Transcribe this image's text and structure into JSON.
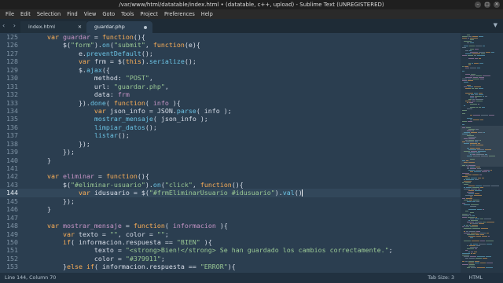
{
  "window": {
    "title": "/var/www/html/datatable/index.html • (datatable, c++, upload) - Sublime Text (UNREGISTERED)",
    "controls": [
      "–",
      "□",
      "✕"
    ]
  },
  "menu": [
    "File",
    "Edit",
    "Selection",
    "Find",
    "View",
    "Goto",
    "Tools",
    "Project",
    "Preferences",
    "Help"
  ],
  "tabs": [
    {
      "label": "index.html",
      "active": false,
      "close": "✕"
    },
    {
      "label": "guardar.php",
      "active": true,
      "dirty": true
    }
  ],
  "tab_nav": "‹ ›",
  "tab_dropdown": "▼",
  "editor": {
    "active_line": 144,
    "lines": [
      {
        "n": "125",
        "tokens": [
          [
            "kw",
            "    var "
          ],
          [
            "nv",
            "guardar"
          ],
          [
            "pl",
            " = "
          ],
          [
            "kw",
            "function"
          ],
          [
            "pl",
            "(){"
          ]
        ]
      },
      {
        "n": "126",
        "tokens": [
          [
            "pl",
            "        $("
          ],
          [
            "str",
            "\"form\""
          ],
          [
            "pl",
            ")."
          ],
          [
            "fn",
            "on"
          ],
          [
            "pl",
            "("
          ],
          [
            "str",
            "\"submit\""
          ],
          [
            "pl",
            ", "
          ],
          [
            "kw",
            "function"
          ],
          [
            "pl",
            "(e){"
          ]
        ]
      },
      {
        "n": "127",
        "tokens": [
          [
            "pl",
            "            e."
          ],
          [
            "fn",
            "preventDefault"
          ],
          [
            "pl",
            "();"
          ]
        ]
      },
      {
        "n": "128",
        "tokens": [
          [
            "kw",
            "            var "
          ],
          [
            "pl",
            "frm = $("
          ],
          [
            "kw",
            "this"
          ],
          [
            "pl",
            ")."
          ],
          [
            "fn",
            "serialize"
          ],
          [
            "pl",
            "();"
          ]
        ]
      },
      {
        "n": "129",
        "tokens": [
          [
            "pl",
            "            $."
          ],
          [
            "fn",
            "ajax"
          ],
          [
            "pl",
            "({"
          ]
        ]
      },
      {
        "n": "130",
        "tokens": [
          [
            "pl",
            "                method: "
          ],
          [
            "str",
            "\"POST\""
          ],
          [
            "pl",
            ","
          ]
        ]
      },
      {
        "n": "131",
        "tokens": [
          [
            "pl",
            "                url: "
          ],
          [
            "str",
            "\"guardar.php\""
          ],
          [
            "pl",
            ","
          ]
        ]
      },
      {
        "n": "132",
        "tokens": [
          [
            "pl",
            "                data: "
          ],
          [
            "nv",
            "frm"
          ]
        ]
      },
      {
        "n": "133",
        "tokens": [
          [
            "pl",
            "            })."
          ],
          [
            "fn",
            "done"
          ],
          [
            "pl",
            "( "
          ],
          [
            "kw",
            "function"
          ],
          [
            "pl",
            "( "
          ],
          [
            "nv",
            "info"
          ],
          [
            "pl",
            " ){"
          ]
        ]
      },
      {
        "n": "134",
        "tokens": [
          [
            "kw",
            "                var "
          ],
          [
            "pl",
            "json_info = JSON."
          ],
          [
            "fn",
            "parse"
          ],
          [
            "pl",
            "( info );"
          ]
        ]
      },
      {
        "n": "135",
        "tokens": [
          [
            "pl",
            "                "
          ],
          [
            "fn",
            "mostrar_mensaje"
          ],
          [
            "pl",
            "( json_info );"
          ]
        ]
      },
      {
        "n": "136",
        "tokens": [
          [
            "pl",
            "                "
          ],
          [
            "fn",
            "limpiar_datos"
          ],
          [
            "pl",
            "();"
          ]
        ]
      },
      {
        "n": "137",
        "tokens": [
          [
            "pl",
            "                "
          ],
          [
            "fn",
            "listar"
          ],
          [
            "pl",
            "();"
          ]
        ]
      },
      {
        "n": "138",
        "tokens": [
          [
            "pl",
            "            });"
          ]
        ]
      },
      {
        "n": "139",
        "tokens": [
          [
            "pl",
            "        });"
          ]
        ]
      },
      {
        "n": "140",
        "tokens": [
          [
            "pl",
            "    }"
          ]
        ]
      },
      {
        "n": "141",
        "tokens": []
      },
      {
        "n": "142",
        "tokens": [
          [
            "kw",
            "    var "
          ],
          [
            "nv",
            "eliminar"
          ],
          [
            "pl",
            " = "
          ],
          [
            "kw",
            "function"
          ],
          [
            "pl",
            "(){"
          ]
        ]
      },
      {
        "n": "143",
        "tokens": [
          [
            "pl",
            "        $("
          ],
          [
            "str",
            "\"#eliminar-usuario\""
          ],
          [
            "pl",
            ")."
          ],
          [
            "fn",
            "on"
          ],
          [
            "pl",
            "("
          ],
          [
            "str",
            "\"click\""
          ],
          [
            "pl",
            ", "
          ],
          [
            "kw",
            "function"
          ],
          [
            "pl",
            "(){"
          ]
        ]
      },
      {
        "n": "144",
        "tokens": [
          [
            "kw",
            "            var "
          ],
          [
            "pl",
            "idusuario = $("
          ],
          [
            "str",
            "\"#frmEliminarUsuario #idusuario\""
          ],
          [
            "pl",
            ")."
          ],
          [
            "fn",
            "val"
          ],
          [
            "pl",
            "()"
          ]
        ],
        "cursor": true
      },
      {
        "n": "145",
        "tokens": [
          [
            "pl",
            "        });"
          ]
        ]
      },
      {
        "n": "146",
        "tokens": [
          [
            "pl",
            "    }"
          ]
        ]
      },
      {
        "n": "147",
        "tokens": []
      },
      {
        "n": "148",
        "tokens": [
          [
            "kw",
            "    var "
          ],
          [
            "nv",
            "mostrar_mensaje"
          ],
          [
            "pl",
            " = "
          ],
          [
            "kw",
            "function"
          ],
          [
            "pl",
            "( "
          ],
          [
            "nv",
            "informacion"
          ],
          [
            "pl",
            " ){"
          ]
        ]
      },
      {
        "n": "149",
        "tokens": [
          [
            "kw",
            "        var "
          ],
          [
            "pl",
            "texto = "
          ],
          [
            "str",
            "\"\""
          ],
          [
            "pl",
            ", color = "
          ],
          [
            "str",
            "\"\""
          ],
          [
            "pl",
            ";"
          ]
        ]
      },
      {
        "n": "150",
        "tokens": [
          [
            "kw",
            "        if"
          ],
          [
            "pl",
            "( informacion.respuesta == "
          ],
          [
            "str",
            "\"BIEN\""
          ],
          [
            "pl",
            " ){"
          ]
        ]
      },
      {
        "n": "151",
        "tokens": [
          [
            "pl",
            "                texto = "
          ],
          [
            "str",
            "\"<strong>Bien!</strong> Se han guardado los cambios correctamente.\""
          ],
          [
            "pl",
            ";"
          ]
        ]
      },
      {
        "n": "152",
        "tokens": [
          [
            "pl",
            "                color = "
          ],
          [
            "str",
            "\"#379911\""
          ],
          [
            "pl",
            ";"
          ]
        ]
      },
      {
        "n": "153",
        "tokens": [
          [
            "pl",
            "        }"
          ],
          [
            "kw",
            "else if"
          ],
          [
            "pl",
            "( informacion.respuesta == "
          ],
          [
            "str",
            "\"ERROR\""
          ],
          [
            "pl",
            "){"
          ]
        ]
      }
    ]
  },
  "status": {
    "position": "Line 144, Column 70",
    "tab_size": "Tab Size: 3",
    "syntax": "HTML"
  }
}
